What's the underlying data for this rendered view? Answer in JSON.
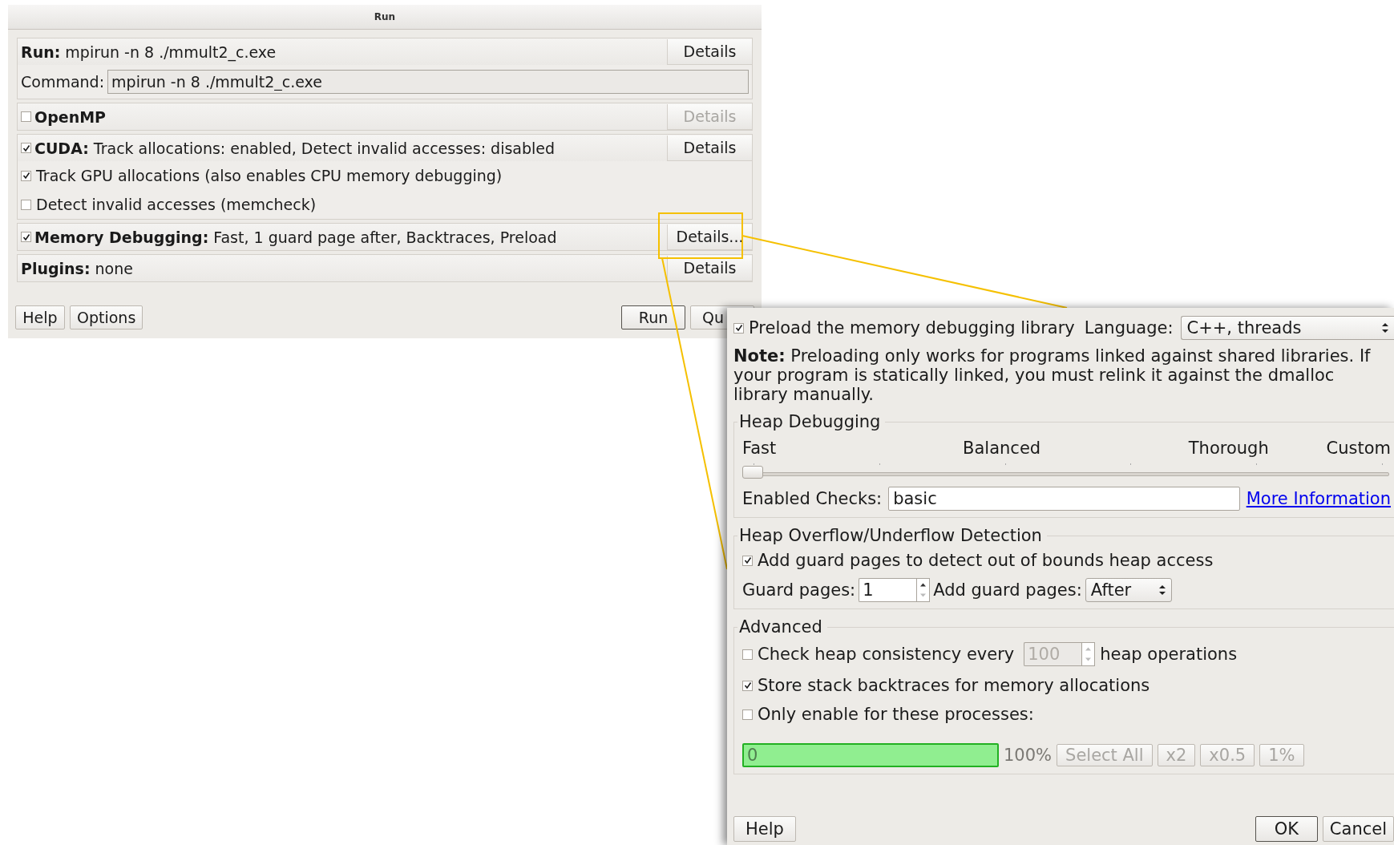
{
  "run_dialog": {
    "title": "Run",
    "run": {
      "label": "Run:",
      "value": "mpirun -n 8 ./mmult2_c.exe",
      "details": {
        "label": "Details",
        "disabled": false
      },
      "command_label": "Command:",
      "command": "mpirun -n 8 ./mmult2_c.exe"
    },
    "openmp": {
      "checked": false,
      "label": "OpenMP",
      "details": {
        "label": "Details",
        "disabled": true
      }
    },
    "cuda": {
      "checked": true,
      "label": "CUDA:",
      "summary": "Track allocations: enabled, Detect invalid accesses: disabled",
      "details": {
        "label": "Details",
        "disabled": false
      },
      "options": [
        {
          "label": "Track GPU allocations (also enables CPU memory debugging)",
          "checked": true
        },
        {
          "label": "Detect invalid accesses (memcheck)",
          "checked": false
        }
      ]
    },
    "memory_debugging": {
      "checked": true,
      "label": "Memory Debugging:",
      "summary": "Fast, 1 guard page after, Backtraces, Preload",
      "details": {
        "label": "Details...",
        "disabled": false
      },
      "highlighted": true
    },
    "plugins": {
      "label": "Plugins:",
      "value": "none",
      "details": {
        "label": "Details",
        "disabled": false
      }
    },
    "buttons": [
      {
        "label": "Help",
        "default": false
      },
      {
        "label": "Options",
        "default": false
      },
      {
        "label": "Run",
        "default": true
      },
      {
        "label": "Qu",
        "default": false
      }
    ]
  },
  "details_dialog": {
    "preload": {
      "label": "Preload the memory debugging library",
      "checked": true
    },
    "language": {
      "label": "Language:",
      "value": "C++, threads"
    },
    "note": "**Note:** Preloading only works for programs linked against shared libraries. If your program is statically linked, you must relink it against the dmalloc library manually.",
    "heap_debugging": {
      "title": "Heap Debugging",
      "scale": [
        "Fast",
        "Balanced",
        "Thorough",
        "Custom"
      ],
      "level": 0,
      "checks_label": "Enabled Checks:",
      "checks": "basic",
      "link": "More Information"
    },
    "overflow": {
      "title": "Heap Overflow/Underflow Detection",
      "guard": {
        "label": "Add guard pages to detect out of bounds heap access",
        "checked": true
      },
      "pages_label": "Guard pages:",
      "pages": "1",
      "position_label": "Add guard pages:",
      "position": "After"
    },
    "advanced": {
      "title": "Advanced",
      "consistency": {
        "label": "Check heap consistency every",
        "checked": false,
        "interval": "100",
        "suffix": "heap operations"
      },
      "backtraces": {
        "label": "Store stack backtraces for memory allocations",
        "checked": true
      },
      "processes": {
        "label": "Only enable for these processes:",
        "checked": false,
        "value": "0",
        "percent": "100%",
        "buttons": [
          "Select All",
          "x2",
          "x0.5",
          "1%"
        ]
      }
    },
    "buttons": [
      {
        "label": "Help",
        "default": false
      },
      {
        "label": "OK",
        "default": true
      },
      {
        "label": "Cancel",
        "default": false
      }
    ]
  }
}
